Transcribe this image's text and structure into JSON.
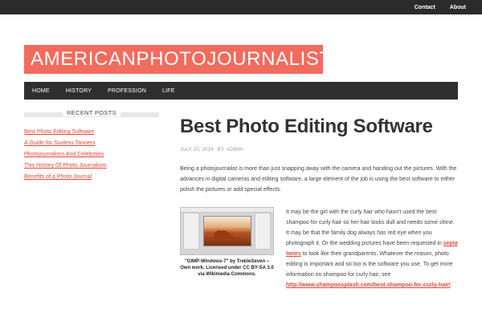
{
  "topbar": {
    "links": [
      "Contact",
      "About"
    ]
  },
  "site": {
    "logo": "AMERICANPHOTOJOURNALIST"
  },
  "nav": {
    "items": [
      "HOME",
      "HISTORY",
      "PROFESSION",
      "LIFE"
    ]
  },
  "sidebar": {
    "title": "RECENT POSTS",
    "items": [
      "Best Photo Editing Software",
      "A Guide for Sunless Tanners",
      "Photojournalism And Celebrities",
      "This History Of Photo Journalism",
      "Benefits of a Photo Journal"
    ]
  },
  "post": {
    "title": "Best Photo Editing Software",
    "date": "JULY 20, 2014",
    "by": "BY",
    "author": "ADMIN",
    "intro": "Being a photojournalist is more than just snapping away with the camera and handing out the pictures. With the advances in digital cameras and editing software, a large element of the job is using the best software to either polish the pictures or add special effects.",
    "figure_caption": "\"GIMP-Windows-7\" by TrebleSeven – Own work. Licensed under CC BY-SA 3.0 via Wikimedia Commons.",
    "para1": "It may be the girl with the curly hair who hasn't used the best shampoo for curly hair so her hair looks dull and needs some shine. It may be that the family dog always has red eye when you photograph it. Or the wedding pictures have been requested in",
    "link1": "sepia tones",
    "para2": "to look like their grandparents. Whatever the reason, photo editing is important and so too is the software you use.  To get more information on shampoo for curly hair, see",
    "link2": "http://www.shampoosplash.com/best-shampoo-for-curly-hair/"
  }
}
